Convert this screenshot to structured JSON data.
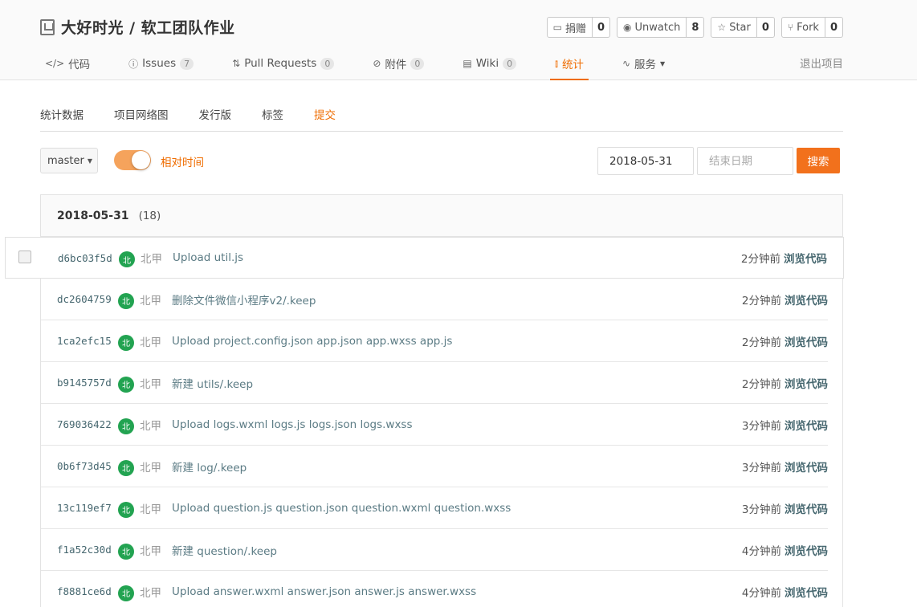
{
  "project": {
    "title": "大好时光 / 软工团队作业"
  },
  "actions": [
    {
      "label": "捐赠",
      "icon": "donate-icon",
      "count": "0"
    },
    {
      "label": "Unwatch",
      "icon": "eye-icon",
      "count": "8"
    },
    {
      "label": "Star",
      "icon": "star-icon",
      "count": "0"
    },
    {
      "label": "Fork",
      "icon": "fork-icon",
      "count": "0"
    }
  ],
  "nav": {
    "items": [
      {
        "label": "代码",
        "icon": "code-icon",
        "badge": null
      },
      {
        "label": "Issues",
        "icon": "issue-icon",
        "badge": "7"
      },
      {
        "label": "Pull Requests",
        "icon": "pull-request-icon",
        "badge": "0"
      },
      {
        "label": "附件",
        "icon": "attachment-icon",
        "badge": "0"
      },
      {
        "label": "Wiki",
        "icon": "wiki-icon",
        "badge": "0"
      },
      {
        "label": "统计",
        "icon": "chart-icon",
        "badge": null,
        "active": true
      },
      {
        "label": "服务",
        "icon": "pulse-icon",
        "badge": null
      }
    ],
    "exit": "退出项目"
  },
  "subtabs": [
    "统计数据",
    "项目网络图",
    "发行版",
    "标签",
    "提交"
  ],
  "filters": {
    "branch": "master",
    "toggle_label": "相对时间",
    "start_date": "2018-05-31",
    "end_placeholder": "结束日期",
    "search_label": "搜索"
  },
  "commit_group": {
    "date": "2018-05-31",
    "count": "(18)"
  },
  "commits": [
    {
      "sha": "d6bc03f5d",
      "avatar": "北",
      "author": "北甲",
      "message": "Upload util.js",
      "time": "2分钟前",
      "browse": "浏览代码"
    },
    {
      "sha": "dc2604759",
      "avatar": "北",
      "author": "北甲",
      "message": "删除文件微信小程序v2/.keep",
      "time": "2分钟前",
      "browse": "浏览代码"
    },
    {
      "sha": "1ca2efc15",
      "avatar": "北",
      "author": "北甲",
      "message": "Upload project.config.json app.json app.wxss app.js",
      "time": "2分钟前",
      "browse": "浏览代码"
    },
    {
      "sha": "b9145757d",
      "avatar": "北",
      "author": "北甲",
      "message": "新建 utils/.keep",
      "time": "2分钟前",
      "browse": "浏览代码"
    },
    {
      "sha": "769036422",
      "avatar": "北",
      "author": "北甲",
      "message": "Upload logs.wxml logs.js logs.json logs.wxss",
      "time": "3分钟前",
      "browse": "浏览代码"
    },
    {
      "sha": "0b6f73d45",
      "avatar": "北",
      "author": "北甲",
      "message": "新建 log/.keep",
      "time": "3分钟前",
      "browse": "浏览代码"
    },
    {
      "sha": "13c119ef7",
      "avatar": "北",
      "author": "北甲",
      "message": "Upload question.js question.json question.wxml question.wxss",
      "time": "3分钟前",
      "browse": "浏览代码"
    },
    {
      "sha": "f1a52c30d",
      "avatar": "北",
      "author": "北甲",
      "message": "新建 question/.keep",
      "time": "4分钟前",
      "browse": "浏览代码"
    },
    {
      "sha": "f8881ce6d",
      "avatar": "北",
      "author": "北甲",
      "message": "Upload answer.wxml answer.json answer.js answer.wxss",
      "time": "4分钟前",
      "browse": "浏览代码"
    }
  ]
}
